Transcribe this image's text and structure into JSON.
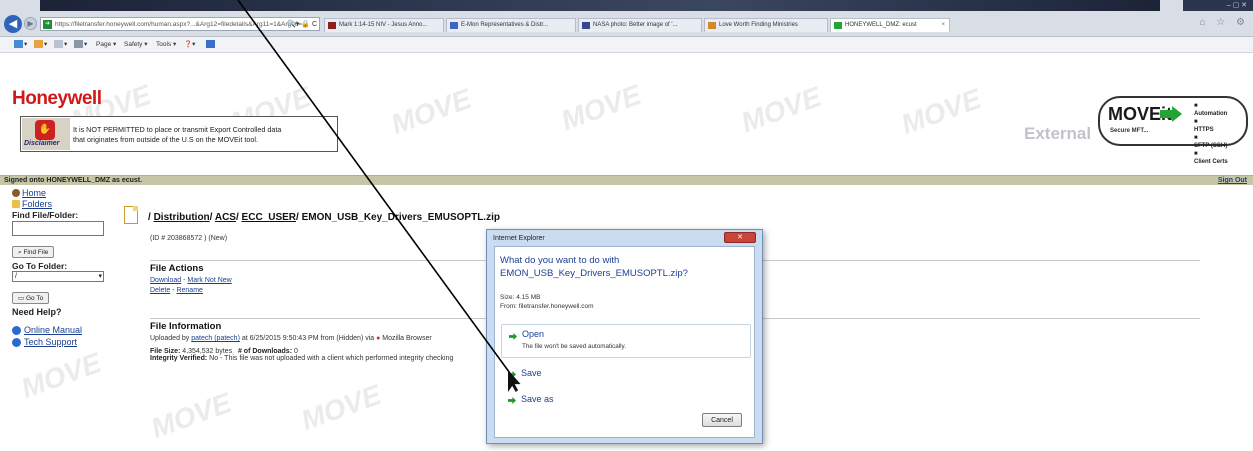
{
  "browser": {
    "address": "https://filetransfer.honeywell.com/human.aspx?...&Arg12=filedetails&Arg11=1&Arg06=...",
    "address_domain": "filetransfer.honeywell.com",
    "tabs": [
      {
        "label": "Mark 1:14-15 NIV - Jesus Anno...",
        "icon_color": "#8a1f1f"
      },
      {
        "label": "E-Mon Representatives & Distr...",
        "icon_color": "#3a66c6"
      },
      {
        "label": "NASA photo: Better image of '...",
        "icon_color": "#334b8c"
      },
      {
        "label": "Love Worth Finding Ministries",
        "icon_color": "#d08a2a"
      },
      {
        "label": "HONEYWELL_DMZ: ecust",
        "icon_color": "#22a535"
      }
    ],
    "tab_close": "×",
    "window_controls": "–  ▢  ✕",
    "right_icons": "⌂ ☆ ⚙",
    "commands": {
      "page": "Page ▾",
      "safety": "Safety ▾",
      "tools": "Tools ▾",
      "help": "❓▾"
    }
  },
  "page": {
    "logo": "Honeywell",
    "disclaimer_badge": "Disclaimer",
    "disclaimer_text_1": "It is NOT PERMITTED to place or transmit Export Controlled data",
    "disclaimer_text_2": "that originates from outside of the U.S on the MOVEit tool.",
    "moveit": {
      "word": "MOVEit",
      "sub": "Secure MFT...",
      "features": [
        "Automation",
        "HTTPS",
        "SFTP (SSH)",
        "Client Certs"
      ]
    },
    "external": "External",
    "watermark": "MOVE",
    "signed_on": "Signed onto HONEYWELL_DMZ as ecust.",
    "sign_out": "Sign Out"
  },
  "sidebar": {
    "home": "Home",
    "folders": "Folders",
    "find_label": "Find File/Folder:",
    "find_value": "",
    "find_button": "Find File",
    "goto_label": "Go To Folder:",
    "goto_value": "/",
    "goto_button": "Go To",
    "help_label": "Need Help?",
    "online_manual": "Online Manual",
    "tech_support": "Tech Support"
  },
  "file": {
    "crumb_root": "/ ",
    "crumb_distribution": "Distribution",
    "crumb_acs": "ACS",
    "crumb_user": "ECC_USER",
    "sep": "/ ",
    "filename": "EMON_USB_Key_Drivers_EMUSOPTL.zip",
    "id_line": "(ID # 203868572 )  (New)",
    "actions_heading": "File Actions",
    "download": "Download",
    "mark_not_new": "Mark Not New",
    "delete": "Delete",
    "rename": "Rename",
    "info_heading": "File Information",
    "uploaded_prefix": "Uploaded by ",
    "uploader": "patech (patech)",
    "uploaded_suffix": " at 6/25/2015 9:50:43 PM from (Hidden) via ",
    "uploaded_via": "Mozilla Browser",
    "size_label": "File Size:",
    "size_value": "4,354,532 bytes",
    "downloads_label": "# of Downloads:",
    "downloads_value": "0",
    "integrity_label": "Integrity Verified:",
    "integrity_value": "No - This file was not uploaded with a client which performed integrity checking"
  },
  "dialog": {
    "title": "Internet Explorer",
    "close": "✕",
    "question_1": "What do you want to do with",
    "question_2": "EMON_USB_Key_Drivers_EMUSOPTL.zip?",
    "size": "Size: 4.15 MB",
    "from": "From: filetransfer.honeywell.com",
    "open_label": "Open",
    "open_note": "The file won't be saved automatically.",
    "save_label": "Save",
    "save_as_label": "Save as",
    "cancel_label": "Cancel"
  },
  "colors": {
    "honeywell_red": "#d2191a",
    "signon_bar": "#c5c6a6",
    "link": "#1a3f8f",
    "dialog_accent": "#1c3f94",
    "go_green": "#1b9a2e"
  }
}
